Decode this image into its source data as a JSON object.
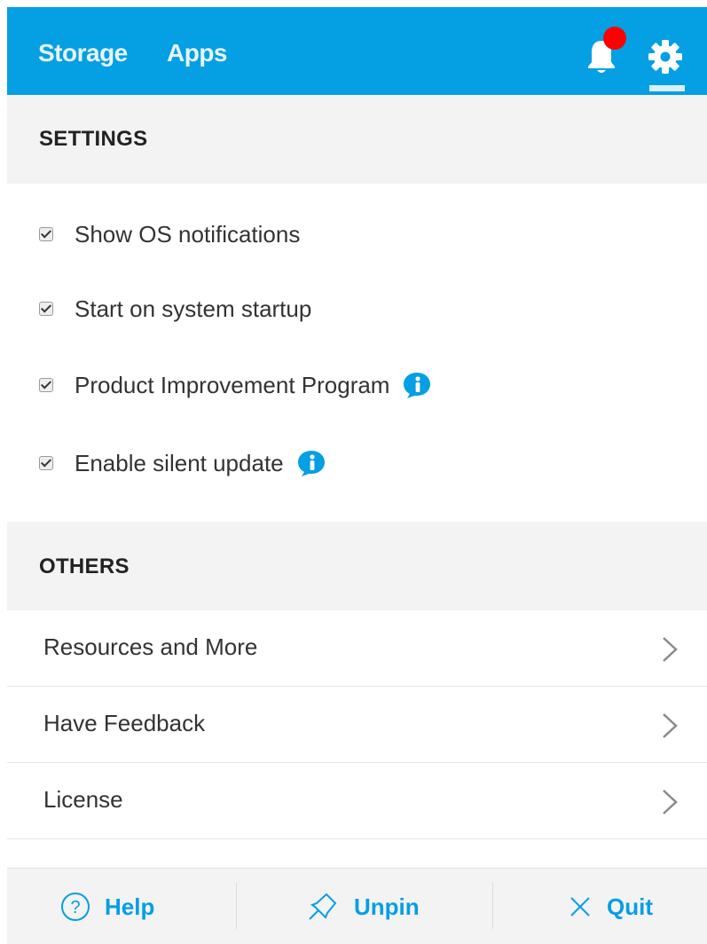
{
  "colors": {
    "accent": "#059fe4",
    "notification_dot": "#ff0000"
  },
  "header": {
    "tabs": [
      {
        "label": "Storage"
      },
      {
        "label": "Apps"
      }
    ],
    "icons": [
      "bell-icon",
      "gear-icon"
    ],
    "has_notification": true
  },
  "settings": {
    "title": "SETTINGS",
    "options": [
      {
        "label": "Show OS notifications",
        "checked": true,
        "info": false
      },
      {
        "label": "Start on system startup",
        "checked": true,
        "info": false
      },
      {
        "label": "Product Improvement Program",
        "checked": true,
        "info": true
      },
      {
        "label": "Enable silent update",
        "checked": true,
        "info": true
      }
    ]
  },
  "others": {
    "title": "OTHERS",
    "items": [
      {
        "label": "Resources and More"
      },
      {
        "label": "Have Feedback"
      },
      {
        "label": "License"
      }
    ]
  },
  "footer": {
    "help_label": "Help",
    "unpin_label": "Unpin",
    "quit_label": "Quit"
  }
}
